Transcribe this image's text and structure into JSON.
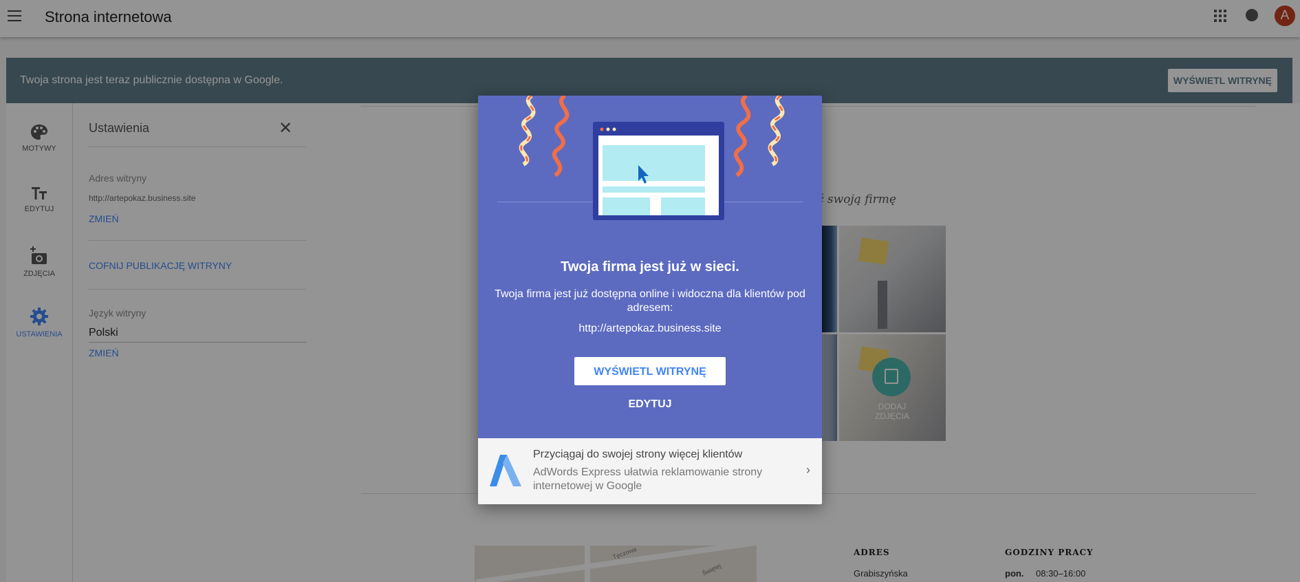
{
  "header": {
    "title": "Strona internetowa",
    "avatar_letter": "A"
  },
  "banner": {
    "text": "Twoja strona jest teraz publicznie dostępna w Google.",
    "button_label": "WYŚWIETL WITRYNĘ"
  },
  "leftnav": {
    "items": [
      {
        "label": "MOTYWY",
        "icon": "palette-icon"
      },
      {
        "label": "EDYTUJ",
        "icon": "text-format-icon"
      },
      {
        "label": "ZDJĘCIA",
        "icon": "add-photo-icon"
      },
      {
        "label": "USTAWIENIA",
        "icon": "gear-icon"
      }
    ]
  },
  "settings": {
    "title": "Ustawienia",
    "address_label": "Adres witryny",
    "address_value": "http://artepokaz.business.site",
    "change_label": "ZMIEŃ",
    "unpublish_label": "COFNIJ PUBLIKACJĘ WITRYNY",
    "language_label": "Język witryny",
    "language_value": "Polski",
    "change_label_2": "ZMIEŃ"
  },
  "site": {
    "tagline": "ć swoją firmę",
    "add_photos_label": "DODAJ ZDJĘCIA",
    "address_heading": "ADRES",
    "address_value": "Grabiszyńska",
    "hours_heading": "GODZINY PRACY",
    "hours_day": "pon.",
    "hours_time": "08:30–16:00",
    "map_label_1": "Tęczowa",
    "map_label_2": "Świętej"
  },
  "dialog": {
    "heading": "Twoja firma jest już w sieci.",
    "body": "Twoja firma jest już dostępna online i widoczna dla klientów pod adresem:",
    "url": "http://artepokaz.business.site",
    "view_button": "WYŚWIETL WITRYNĘ",
    "edit_button": "EDYTUJ",
    "promo_title": "Przyciągaj do swojej strony więcej klientów",
    "promo_text": "AdWords Express ułatwia reklamowanie strony internetowej w Google"
  },
  "colors": {
    "accent": "#4285f4",
    "banner": "#607d8b",
    "dialog": "#5c6bc0",
    "avatar": "#c5401f",
    "teal": "#4db6ac"
  }
}
